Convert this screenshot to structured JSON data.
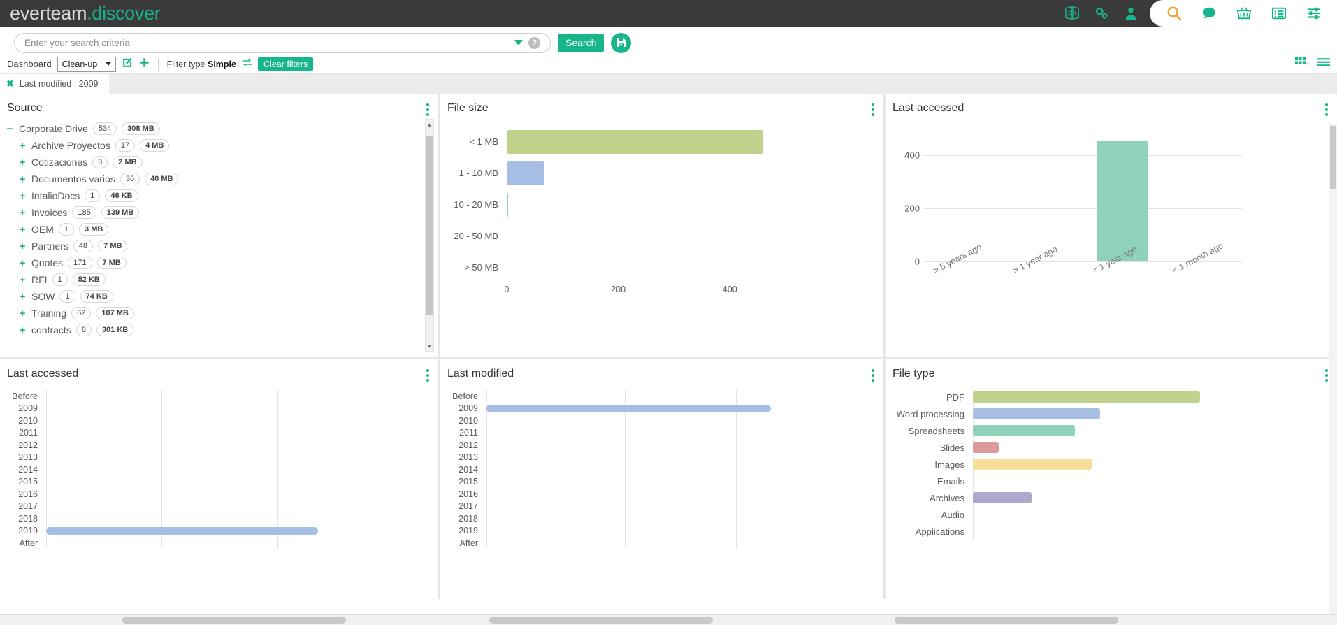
{
  "app": {
    "brand_part1": "everteam",
    "brand_part2": ".discover"
  },
  "topbar": {
    "icons": [
      {
        "name": "translate-icon",
        "label": "Translate"
      },
      {
        "name": "gears-icon",
        "label": "Settings"
      },
      {
        "name": "user-icon",
        "label": "User"
      },
      {
        "name": "search-icon",
        "label": "Search"
      },
      {
        "name": "chat-icon",
        "label": "Chat"
      },
      {
        "name": "basket-icon",
        "label": "Basket"
      },
      {
        "name": "list-icon",
        "label": "List"
      },
      {
        "name": "sliders-icon",
        "label": "Preferences"
      }
    ]
  },
  "search": {
    "placeholder": "Enter your search criteria",
    "value": "",
    "dropdown_icon": "chevron-down-icon",
    "help_icon": "help-icon",
    "help_label": "?",
    "search_button": "Search",
    "save_icon": "floppy-save-icon"
  },
  "toolbar": {
    "dashboard_label": "Dashboard",
    "dashboard_value": "Clean-up",
    "edit_icon": "edit-pencil-icon",
    "add_icon": "plus-icon",
    "filter_type_label": "Filter type",
    "filter_type_value": "Simple",
    "swap_icon": "swap-arrows-icon",
    "clear_filters": "Clear filters",
    "view_grid_icon": "grid-view-icon",
    "view_list_icon": "list-view-icon"
  },
  "filter_chips": [
    {
      "close_icon": "close-x-icon",
      "label": "Last modified : 2009"
    }
  ],
  "panels": {
    "source": {
      "title": "Source",
      "kebab_icon": "kebab-menu-icon",
      "items": [
        {
          "toggle": "−",
          "label": "Corporate Drive",
          "count": "534",
          "size": "308 MB",
          "level": 0
        },
        {
          "toggle": "+",
          "label": "Archive Proyectos",
          "count": "17",
          "size": "4 MB",
          "level": 1
        },
        {
          "toggle": "+",
          "label": "Cotizaciones",
          "count": "3",
          "size": "2 MB",
          "level": 1
        },
        {
          "toggle": "+",
          "label": "Documentos varios",
          "count": "36",
          "size": "40 MB",
          "level": 1
        },
        {
          "toggle": "+",
          "label": "IntalioDocs",
          "count": "1",
          "size": "46 KB",
          "level": 1
        },
        {
          "toggle": "+",
          "label": "Invoices",
          "count": "185",
          "size": "139 MB",
          "level": 1
        },
        {
          "toggle": "+",
          "label": "OEM",
          "count": "1",
          "size": "3 MB",
          "level": 1
        },
        {
          "toggle": "+",
          "label": "Partners",
          "count": "48",
          "size": "7 MB",
          "level": 1
        },
        {
          "toggle": "+",
          "label": "Quotes",
          "count": "171",
          "size": "7 MB",
          "level": 1
        },
        {
          "toggle": "+",
          "label": "RFI",
          "count": "1",
          "size": "52 KB",
          "level": 1
        },
        {
          "toggle": "+",
          "label": "SOW",
          "count": "1",
          "size": "74 KB",
          "level": 1
        },
        {
          "toggle": "+",
          "label": "Training",
          "count": "62",
          "size": "107 MB",
          "level": 1
        },
        {
          "toggle": "+",
          "label": "contracts",
          "count": "8",
          "size": "301 KB",
          "level": 1
        }
      ]
    },
    "file_size": {
      "title": "File size",
      "kebab_icon": "kebab-menu-icon"
    },
    "last_accessed_top": {
      "title": "Last accessed",
      "kebab_icon": "kebab-menu-icon"
    },
    "last_accessed_bottom": {
      "title": "Last accessed",
      "kebab_icon": "kebab-menu-icon"
    },
    "last_modified": {
      "title": "Last modified",
      "kebab_icon": "kebab-menu-icon"
    },
    "file_type": {
      "title": "File type",
      "kebab_icon": "kebab-menu-icon"
    }
  },
  "colors": {
    "brand_green": "#17b58b",
    "dark_header": "#3a3a3a",
    "orange_accent": "#f0a030",
    "bar_olive": "#bfd18a",
    "bar_blue": "#a6bde4",
    "bar_teal": "#8ed3b9",
    "bar_red": "#dd9a9a",
    "bar_yellow": "#f6dd9a",
    "bar_purple": "#b0a8cc"
  },
  "chart_data": [
    {
      "id": "file_size",
      "type": "bar",
      "orientation": "horizontal",
      "title": "File size",
      "categories": [
        "< 1 MB",
        "1 - 10 MB",
        "10 - 20 MB",
        "20 - 50 MB",
        "> 50 MB"
      ],
      "values": [
        460,
        68,
        3,
        0,
        0
      ],
      "colors": [
        "#bfd18a",
        "#a6bde4",
        "#8ed3b9",
        "#dd9a9a",
        "#f6dd9a"
      ],
      "xlabel": "",
      "ylabel": "",
      "xlim": [
        0,
        520
      ],
      "xticks": [
        0,
        200,
        400
      ],
      "grid": true,
      "legend": "none"
    },
    {
      "id": "last_accessed_top",
      "type": "bar",
      "orientation": "vertical",
      "title": "Last accessed",
      "categories": [
        "> 5 years ago",
        "> 1 year ago",
        "< 1 year ago",
        "< 1 month ago"
      ],
      "values": [
        0,
        0,
        455,
        0
      ],
      "colors": [
        "#8ed3b9",
        "#8ed3b9",
        "#8ed3b9",
        "#8ed3b9"
      ],
      "xlabel": "",
      "ylabel": "",
      "ylim": [
        0,
        500
      ],
      "yticks": [
        0,
        200,
        400
      ],
      "grid": true,
      "legend": "none"
    },
    {
      "id": "last_accessed_bottom",
      "type": "bar",
      "orientation": "horizontal",
      "title": "Last accessed",
      "categories": [
        "Before 2009",
        "2010",
        "2011",
        "2012",
        "2013",
        "2014",
        "2015",
        "2016",
        "2017",
        "2018",
        "2019",
        "After"
      ],
      "values": [
        0,
        0,
        0,
        0,
        0,
        0,
        0,
        0,
        0,
        0,
        470,
        0
      ],
      "colors": [
        "#a6bde4"
      ],
      "xlabel": "",
      "ylabel": "",
      "xlim": [
        0,
        520
      ],
      "grid": true,
      "legend": "none"
    },
    {
      "id": "last_modified",
      "type": "bar",
      "orientation": "horizontal",
      "title": "Last modified",
      "categories": [
        "Before 2009",
        "2010",
        "2011",
        "2012",
        "2013",
        "2014",
        "2015",
        "2016",
        "2017",
        "2018",
        "2019",
        "After"
      ],
      "values": [
        530,
        0,
        0,
        0,
        0,
        0,
        0,
        0,
        0,
        0,
        0,
        0
      ],
      "colors": [
        "#a6bde4"
      ],
      "xlabel": "",
      "ylabel": "",
      "xlim": [
        0,
        560
      ],
      "grid": true,
      "legend": "none"
    },
    {
      "id": "file_type",
      "type": "bar",
      "orientation": "horizontal",
      "title": "File type",
      "categories": [
        "PDF",
        "Word processing",
        "Spreadsheets",
        "Slides",
        "Images",
        "Emails",
        "Archives",
        "Audio",
        "Applications"
      ],
      "values": [
        330,
        185,
        148,
        38,
        172,
        0,
        85,
        0,
        0
      ],
      "colors": [
        "#bfd18a",
        "#a6bde4",
        "#8ed3b9",
        "#dd9a9a",
        "#f6dd9a",
        "#cfcfcf",
        "#b0a8cc",
        "#9fc8d8",
        "#d8c2a8"
      ],
      "xlabel": "",
      "ylabel": "",
      "xlim": [
        0,
        350
      ],
      "grid": true,
      "legend": "none"
    }
  ],
  "axis_labels": {
    "file_size_ticks": [
      "0",
      "200",
      "400"
    ],
    "last_accessed_top_yticks": [
      "400",
      "200",
      "0"
    ],
    "last_accessed_top_xticks": [
      "> 5 years ago",
      "> 1 year ago",
      "< 1 year ago",
      "< 1 month ago"
    ],
    "year_rows": [
      "Before",
      "2009",
      "2010",
      "2011",
      "2012",
      "2013",
      "2014",
      "2015",
      "2016",
      "2017",
      "2018",
      "2019",
      "After"
    ],
    "file_type_rows": [
      "PDF",
      "Word processing",
      "Spreadsheets",
      "Slides",
      "Images",
      "Emails",
      "Archives",
      "Audio",
      "Applications"
    ]
  }
}
